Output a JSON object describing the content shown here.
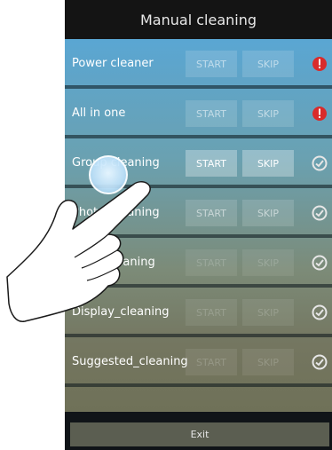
{
  "header": {
    "title": "Manual cleaning"
  },
  "rows": [
    {
      "label": "Power cleaner",
      "start": "START",
      "skip": "SKIP",
      "status_icon": "alert-icon"
    },
    {
      "label": "All in one",
      "start": "START",
      "skip": "SKIP",
      "status_icon": "alert-icon"
    },
    {
      "label": "Group cleaning",
      "start": "START",
      "skip": "SKIP",
      "status_icon": "check-icon"
    },
    {
      "label": "Photo_cleaning",
      "start": "START",
      "skip": "SKIP",
      "status_icon": "check-icon"
    },
    {
      "label": "Apps_cleaning",
      "start": "START",
      "skip": "SKIP",
      "status_icon": "check-icon"
    },
    {
      "label": "Display_cleaning",
      "start": "START",
      "skip": "SKIP",
      "status_icon": "check-icon"
    },
    {
      "label": "Suggested_cleaning",
      "start": "START",
      "skip": "SKIP",
      "status_icon": "check-icon"
    }
  ],
  "footer": {
    "exit_label": "Exit"
  },
  "colors": {
    "alert": "#d92b2b",
    "check": "#e6e6e6"
  }
}
